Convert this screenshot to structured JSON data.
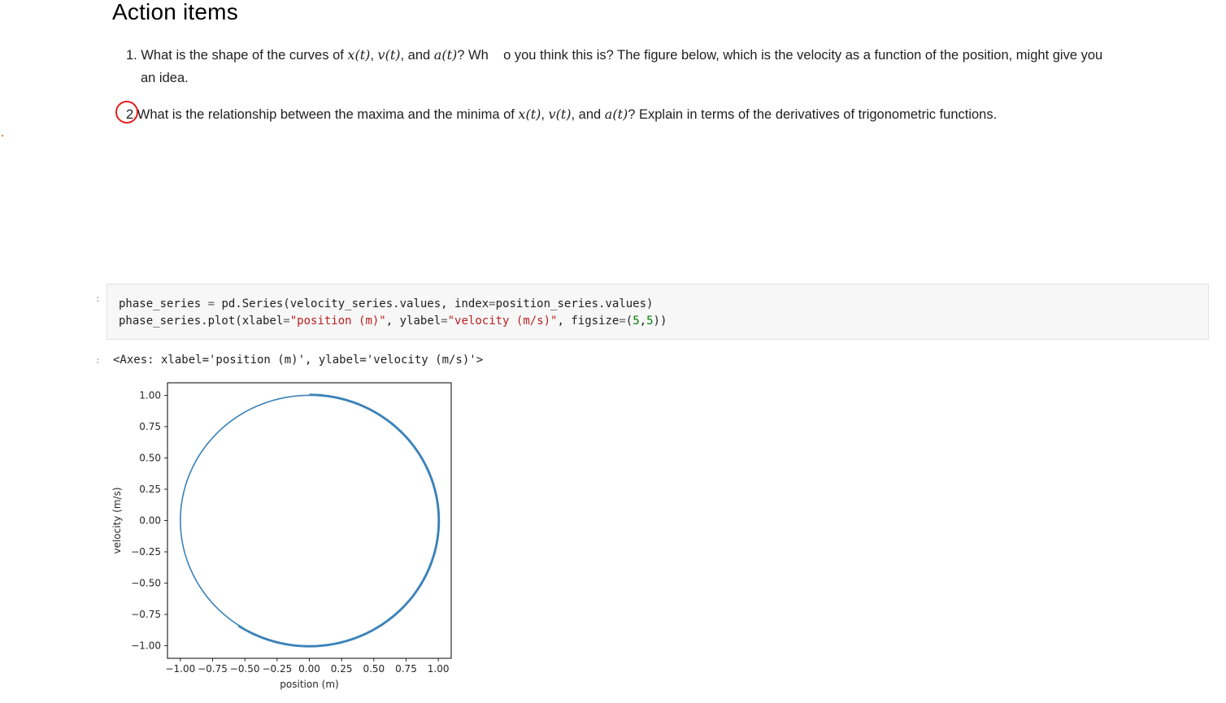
{
  "heading": "Action items",
  "items": [
    {
      "number": "1.",
      "pre": "What is the shape of the curves of ",
      "x_sym": "x(t)",
      "sep1": ", ",
      "v_sym": "v(t)",
      "sep2": ", and ",
      "a_sym": "a(t)",
      "mid": "? Wh",
      "rest": "o you think this is? The figure below, which is the velocity as a function of the position, might give you",
      "continuation": "an idea."
    },
    {
      "number": "2.",
      "pre": "What is the relationship between the maxima and the minima of ",
      "x_sym": "x(t)",
      "sep1": ", ",
      "v_sym": "v(t)",
      "sep2": ", and ",
      "a_sym": "a(t)",
      "post": "? Explain in terms of the derivatives of trigonometric functions."
    }
  ],
  "code_cell": {
    "prompt": ":",
    "line1": {
      "a": "phase_series ",
      "op": "=",
      "b": " pd.Series(velocity_series.values, index",
      "op2": "=",
      "c": "position_series.values)"
    },
    "line2": {
      "a": "phase_series.plot(xlabel",
      "op": "=",
      "s1": "\"position (m)\"",
      "b": ", ylabel",
      "op2": "=",
      "s2": "\"velocity (m/s)\"",
      "c": ", figsize",
      "op3": "=",
      "d": "(",
      "n1": "5",
      "e": ",",
      "n2": "5",
      "f": "))"
    }
  },
  "output": {
    "prompt": ":",
    "text": "<Axes: xlabel='position (m)', ylabel='velocity (m/s)'>"
  },
  "chart_data": {
    "type": "line",
    "title": "",
    "xlabel": "position (m)",
    "ylabel": "velocity (m/s)",
    "xlim": [
      -1.1,
      1.1
    ],
    "ylim": [
      -1.1,
      1.1
    ],
    "xticks": [
      "−1.00",
      "−0.75",
      "−0.50",
      "−0.25",
      "0.00",
      "0.25",
      "0.50",
      "0.75",
      "1.00"
    ],
    "yticks": [
      "1.00",
      "0.75",
      "0.50",
      "0.25",
      "0.00",
      "−0.25",
      "−0.50",
      "−0.75",
      "−1.00"
    ],
    "tick_values": [
      -1.0,
      -0.75,
      -0.5,
      -0.25,
      0.0,
      0.25,
      0.5,
      0.75,
      1.0
    ],
    "grid": false,
    "legend": "none",
    "series": [
      {
        "curve": "unit circle: position = cos(θ), velocity = sin(θ), traced fully once plus an overlapping arc from velocity 1.00 through position 1.00 to velocity −1.00",
        "center": [
          0.0,
          0.0
        ],
        "radius": 1.0,
        "overlap_arc_start": [
          0.0,
          1.0
        ],
        "overlap_arc_end": [
          -0.55,
          -0.84
        ],
        "color": "#3b82b8"
      }
    ]
  },
  "colors": {
    "line": "#3b82b8",
    "annotation": "#e0201c",
    "code_bg": "#f7f7f7"
  }
}
